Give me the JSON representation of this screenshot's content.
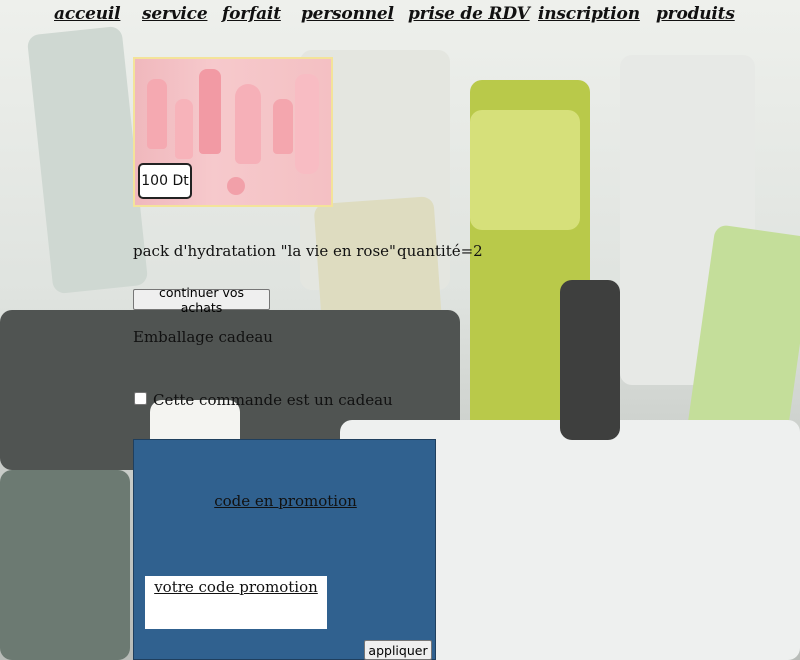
{
  "nav": {
    "items": [
      "acceuil",
      "service",
      "forfait",
      "personnel",
      "prise de RDV",
      "inscription",
      "produits"
    ]
  },
  "product": {
    "price_tag": "100 Dt",
    "name": "pack d'hydratation \"la vie en rose\"",
    "quantity": "quantité=2"
  },
  "actions": {
    "continue_label": "continuer vos achats"
  },
  "gift": {
    "section_label": "Emballage cadeau",
    "checkbox_label": "Cette commande est un cadeau",
    "checked": false
  },
  "promo": {
    "title": "code en promotion",
    "input_label": "votre code promotion",
    "apply_label": "appliquer"
  },
  "colors": {
    "promo_panel": "#30618f",
    "product_frame": "#f3e39a"
  }
}
